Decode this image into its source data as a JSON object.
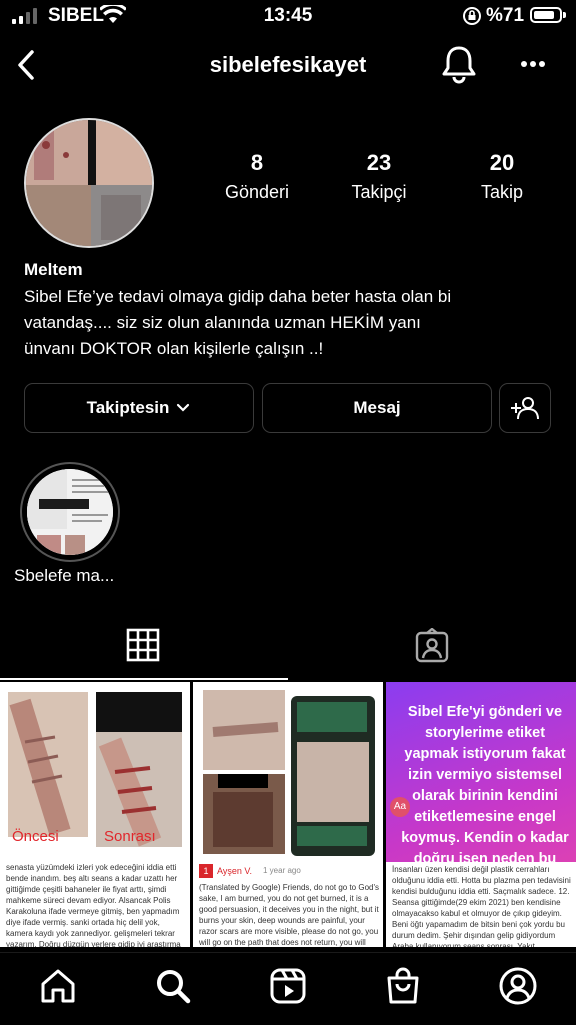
{
  "status": {
    "carrier": "SIBEL",
    "time": "13:45",
    "battery": "%71"
  },
  "header": {
    "username": "sibelefesikayet"
  },
  "profile": {
    "stats": [
      {
        "value": "8",
        "label": "Gönderi"
      },
      {
        "value": "23",
        "label": "Takipçi"
      },
      {
        "value": "20",
        "label": "Takip"
      }
    ],
    "name": "Meltem",
    "bio_lines": [
      "Sibel Efe’ye tedavi olmaya gidip daha beter hasta olan bi",
      "vatandaş.... siz siz olun alanında uzman HEKİM yanı",
      "ünvanı DOKTOR olan kişilerle çalışın ..!"
    ]
  },
  "actions": {
    "following_label": "Takiptesin",
    "message_label": "Mesaj"
  },
  "highlights": [
    {
      "label": "Sbelefe ma..."
    }
  ],
  "posts": {
    "p1": {
      "before_label": "Öncesi",
      "after_label": "Sonrası",
      "caption": "senasta yüzümdeki izleri yok edeceğini iddia etti bende inandım. beş altı seans a kadar uzattı her gittiğimde çeşitli bahaneler ile fiyat arttı, şimdi mahkeme süreci devam ediyor. Alsancak Polis Karakoluna ifade vermeye gitmiş, ben yapmadım diye ifade vermiş. sanki ortada hiç delil yok, kamera kaydı yok zannediyor. gelişmeleri tekrar yazarım. Doğru düzgün yerlere gidip iyi araştırma yapın"
    },
    "p2": {
      "reviewer": "Ayşen V.",
      "review_time": "1 year ago",
      "caption": "(Translated by Google) Friends, do not go to God's sake, I am burned, you do not get burned, it is a good persuasion, it deceives you in the night, but it burns your skin, deep wounds are painful, your razor scars are more visible, please do not go, you will go on the path that does not return, you will look for the old scars, please go to the"
    },
    "p3": {
      "text": "Sibel Efe'yi gönderi ve storylerime etiket yapmak istiyorum fakat izin vermiyo sistemsel olarak birinin kendini etiketlemesine engel koymuş. Kendin o kadar doğru isen neden bu engel..!",
      "caption": "İnsanları üzen kendisi değil plastik cerrahları olduğunu iddia etti. Hotta bu plazma pen tedavisini kendisi bulduğunu iddia etti. Saçmalık sadece. 12. Seansa gittiğimde(29 ekim 2021) ben kendisine olmayacakso kabul et olmuyor de çıkıp gideyim. Beni öğtı yapamadım de bitsin beni çok yordu bu durum dedim. Şehir dışından gelip gidiyordum Araba kullanıyorum seans sonrası. Yakıt harcıyorum"
    }
  },
  "colors": {
    "background": "#000000",
    "text": "#ffffff",
    "button_border": "#3a3a3a",
    "accent_red": "#d9262b"
  }
}
